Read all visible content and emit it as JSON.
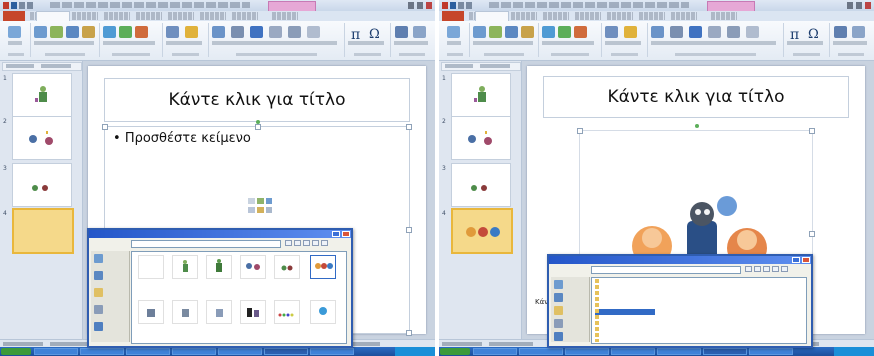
{
  "left": {
    "slide_title": "Κάντε κλικ για τίτλο",
    "bullet_text": "Προσθέστε κείμενο",
    "thumb_numbers": [
      "1",
      "2",
      "3",
      "4"
    ],
    "dialog": {
      "title": "",
      "look_in_label": "",
      "look_in_value": "",
      "places": [
        "",
        "",
        "",
        "",
        ""
      ],
      "files": [
        "",
        "",
        "",
        "",
        "",
        "",
        "",
        "",
        "",
        "",
        "",
        ""
      ]
    }
  },
  "right": {
    "slide_title": "Κάντε κλικ για τίτλο",
    "thumb_numbers": [
      "1",
      "2",
      "3",
      "4"
    ],
    "partial_bullet": "Κάντε κλικ γ",
    "dialog": {
      "title": "",
      "look_in_label": "",
      "look_in_value": "",
      "places": [
        "",
        "",
        "",
        "",
        ""
      ],
      "files": [
        "",
        "",
        "",
        "",
        "",
        "",
        "",
        "",
        "",
        "",
        ""
      ]
    }
  },
  "ribbon": {
    "symbols": [
      "π",
      "Ω"
    ]
  },
  "colors": {
    "file_tab": "#c6462a",
    "context_tab": "#e6a8d6",
    "taskbar": "#1b4e9c",
    "dialog_titlebar": "#2456c9",
    "selected_slide": "#f5d98a"
  }
}
